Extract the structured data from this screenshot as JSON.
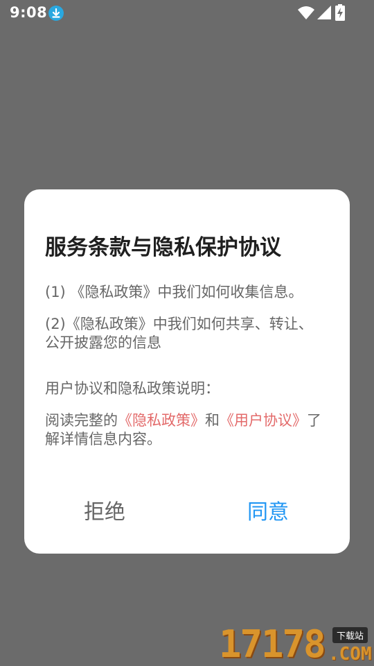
{
  "status_bar": {
    "time": "9:08",
    "icons": [
      "download-icon",
      "wifi-icon",
      "signal-icon",
      "battery-charging-icon"
    ]
  },
  "dialog": {
    "title": "服务条款与隐私保护协议",
    "paragraph1": "(1) 《隐私政策》中我们如何收集信息。",
    "paragraph2": "(2)《隐私政策》中我们如何共享、转让、公开披露您的信息",
    "paragraph3": "用户协议和隐私政策说明：",
    "paragraph4": {
      "prefix": "阅读完整的",
      "privacy_link": "《隐私政策》",
      "middle": "和",
      "user_link": "《用户协议》",
      "suffix": "了解详情信息内容。"
    },
    "reject_label": "拒绝",
    "agree_label": "同意"
  },
  "watermark": {
    "number": "17178",
    "badge": "下载站",
    "domain": ".COM"
  },
  "colors": {
    "overlay": "#6b6b6b",
    "link": "#e36a6a",
    "accent": "#2196f3",
    "text_secondary": "#666666"
  }
}
